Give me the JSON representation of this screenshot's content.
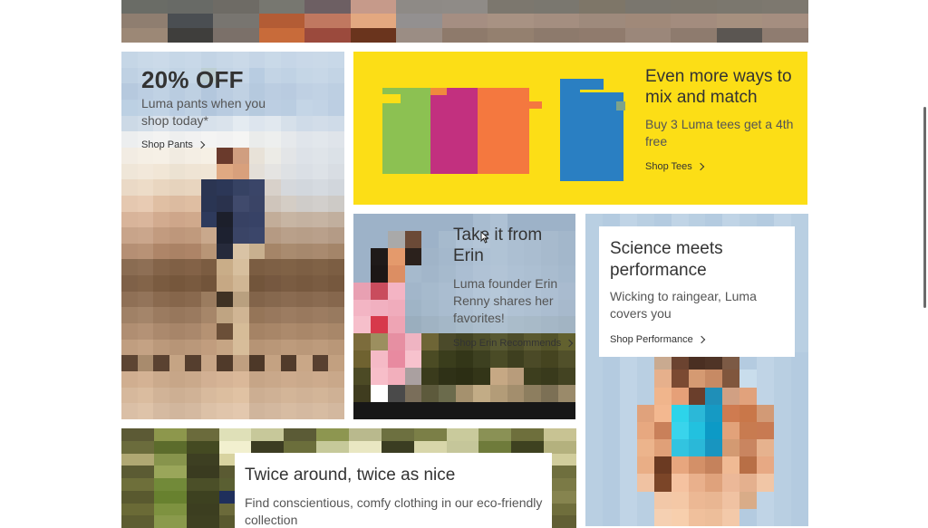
{
  "pants_promo": {
    "title": "20% OFF",
    "subtitle": "Luma pants when you shop today*",
    "link": "Shop Pants"
  },
  "tees_promo": {
    "title": "Even more ways to mix and match",
    "subtitle": "Buy 3 Luma tees get a 4th free",
    "link": "Shop Tees"
  },
  "erin_promo": {
    "title": "Take it from Erin",
    "subtitle": "Luma founder Erin Renny shares her favorites!",
    "link": "Shop Erin Recommends"
  },
  "performance_promo": {
    "title": "Science meets performance",
    "subtitle": "Wicking to raingear, Luma covers you",
    "link": "Shop Performance"
  },
  "eco_promo": {
    "title": "Twice around, twice as nice",
    "subtitle": "Find conscientious, comfy clothing in our eco-friendly collection"
  },
  "colors": {
    "promo_yellow": "#fcde16",
    "text_dark": "#333333"
  }
}
